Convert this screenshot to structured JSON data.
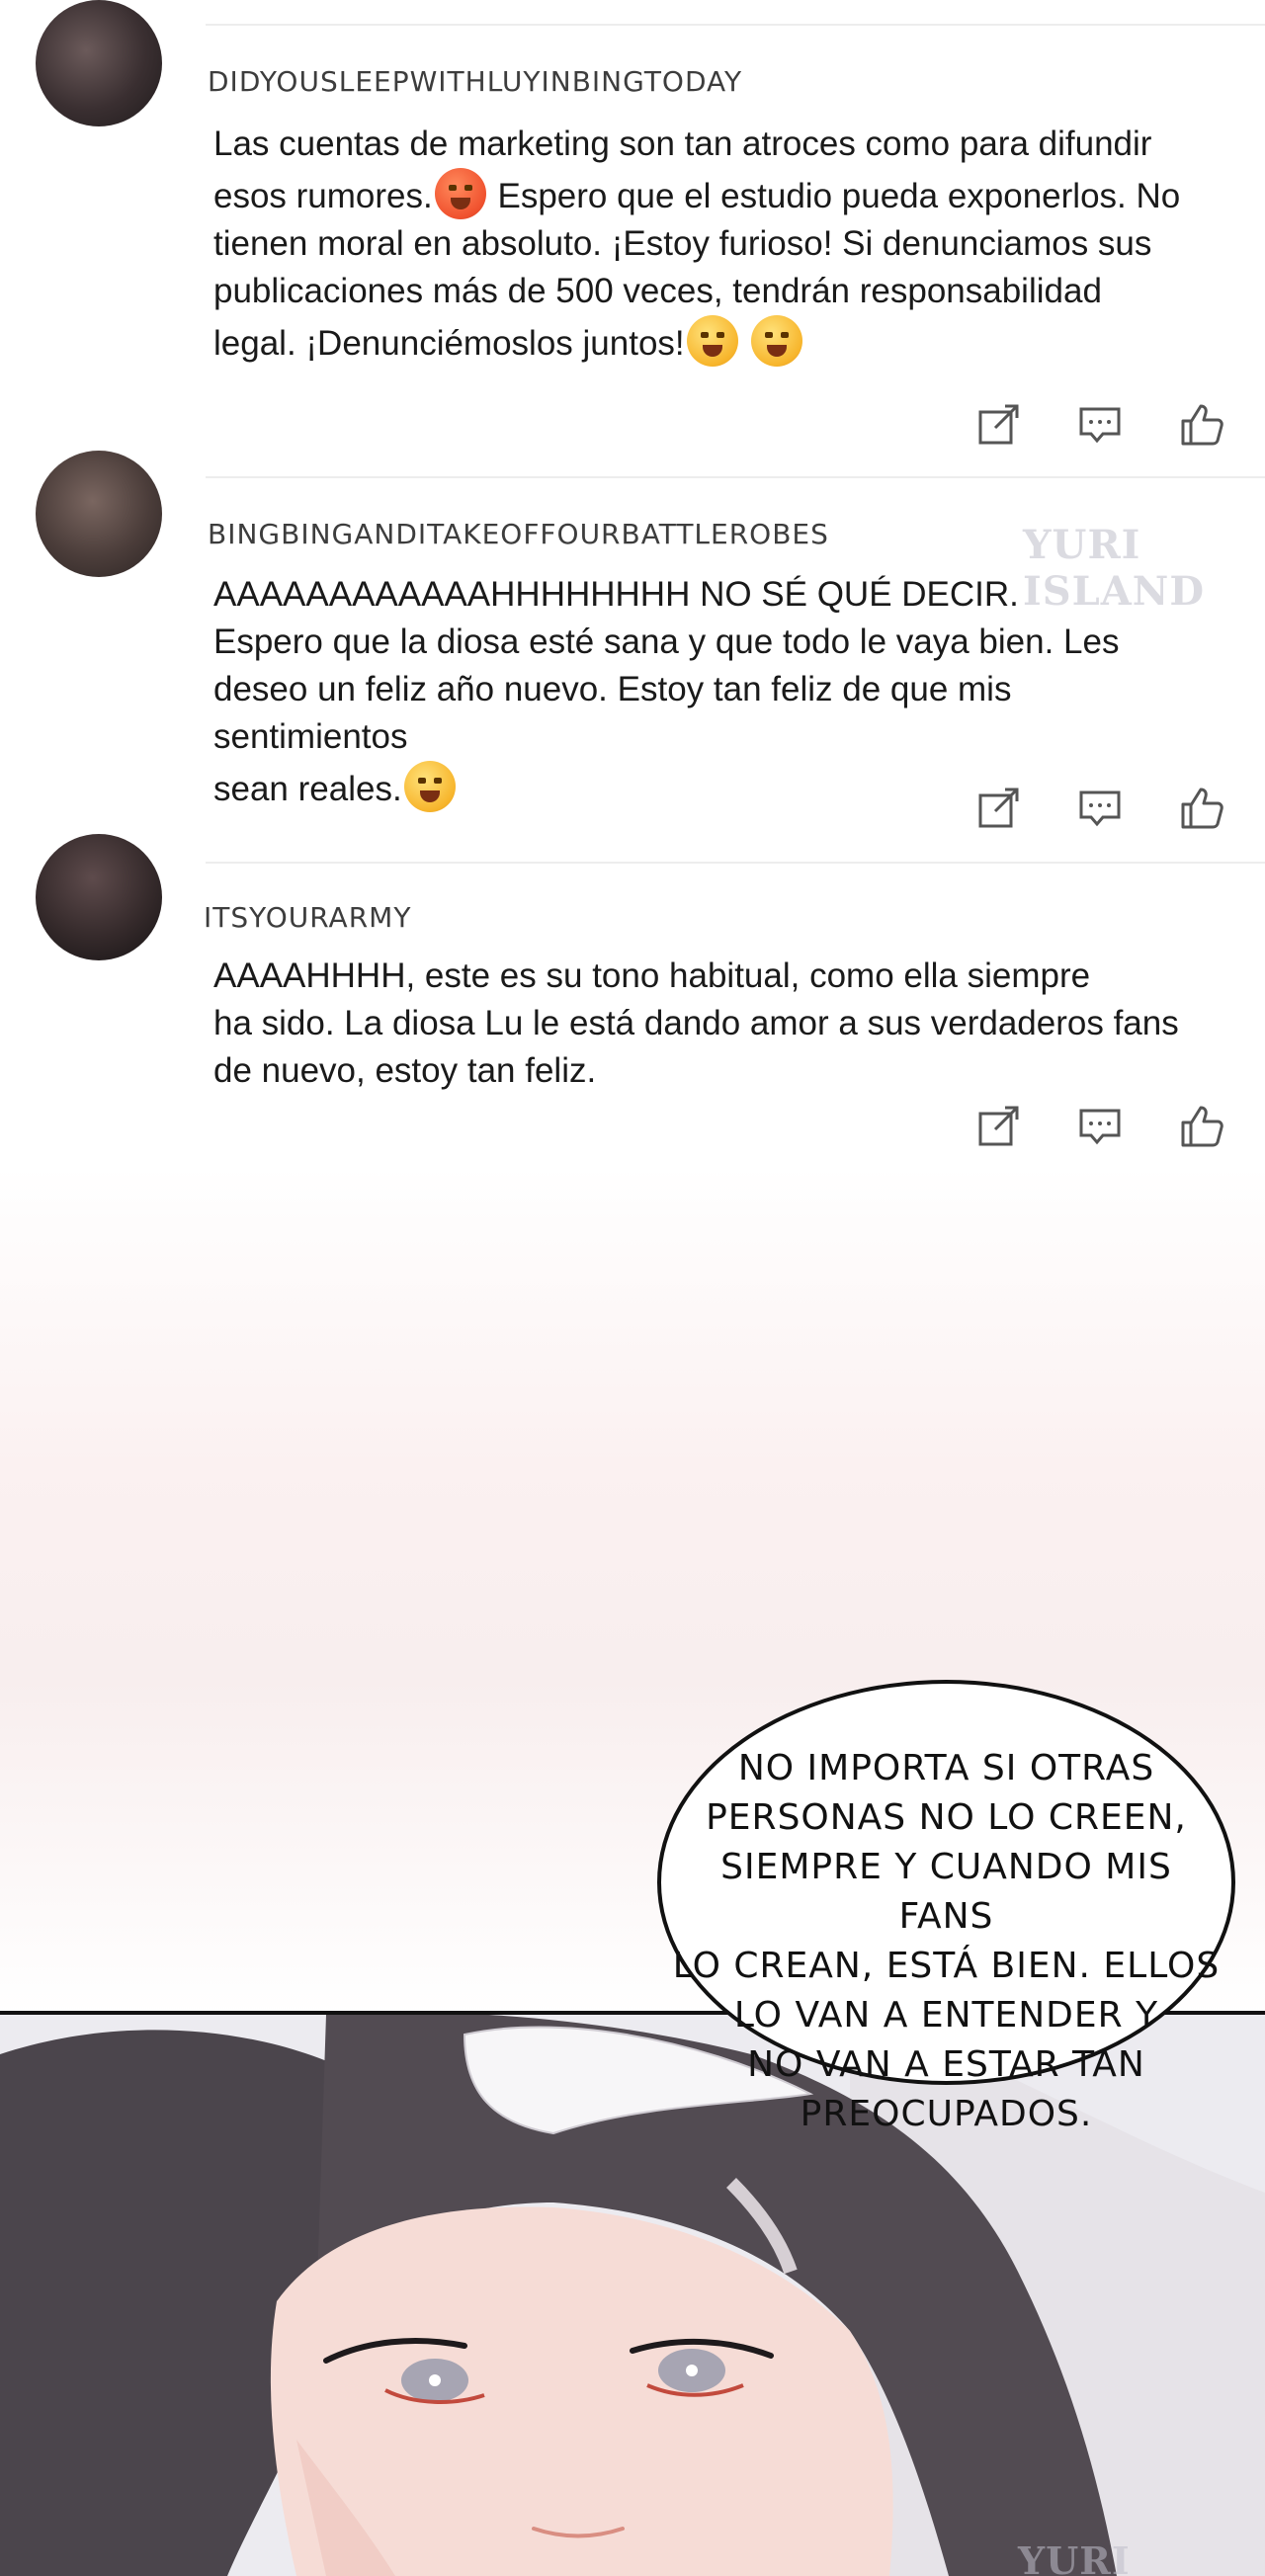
{
  "comments": [
    {
      "username": "DIDYOUSLEEPWITHLUYINBINGTODAY",
      "lines": [
        "Las cuentas de marketing son tan atroces como para difundir",
        "esos rumores.",
        " Espero que el estudio pueda exponerlos. No",
        "tienen moral en absoluto. ¡Estoy furioso! Si denunciamos sus",
        "publicaciones más de 500 veces, tendrán responsabilidad",
        "legal. ¡Denunciémoslos juntos!"
      ],
      "emojis": [
        "angry-face-emoji",
        "shouting-face-emoji",
        "shouting-face-emoji"
      ]
    },
    {
      "username": "BINGBINGANDITAKEOFFOURBATTLEROBES",
      "lines": [
        "AAAAAAAAAAAAHHHHHHHH NO SÉ QUÉ DECIR.",
        "Espero que la diosa esté sana y que todo le vaya bien. Les",
        "deseo un feliz año nuevo. Estoy tan feliz de que mis sentimientos",
        "sean reales."
      ],
      "emojis": [
        "crying-face-emoji"
      ]
    },
    {
      "username": "ITSYOURARMY",
      "lines": [
        "AAAAHHHH, este es su tono habitual, como ella siempre",
        "ha sido. La diosa Lu le está dando amor a sus verdaderos fans",
        "de nuevo, estoy tan feliz."
      ],
      "emojis": []
    }
  ],
  "actions": {
    "icons": [
      "share-icon",
      "comment-icon",
      "like-icon"
    ]
  },
  "watermark": "YURI ISLAND",
  "speech_bubble": {
    "lines": [
      "NO IMPORTA SI OTRAS",
      "PERSONAS NO LO CREEN,",
      "SIEMPRE Y CUANDO MIS FANS",
      "LO CREAN, ESTÁ BIEN. ELLOS",
      "LO VAN A ENTENDER Y",
      "NO VAN A ESTAR TAN",
      "PREOCUPADOS."
    ]
  },
  "colors": {
    "text": "#1a1a1a",
    "username": "#3d3d3d",
    "icon": "#555555",
    "divider": "#ededed"
  }
}
